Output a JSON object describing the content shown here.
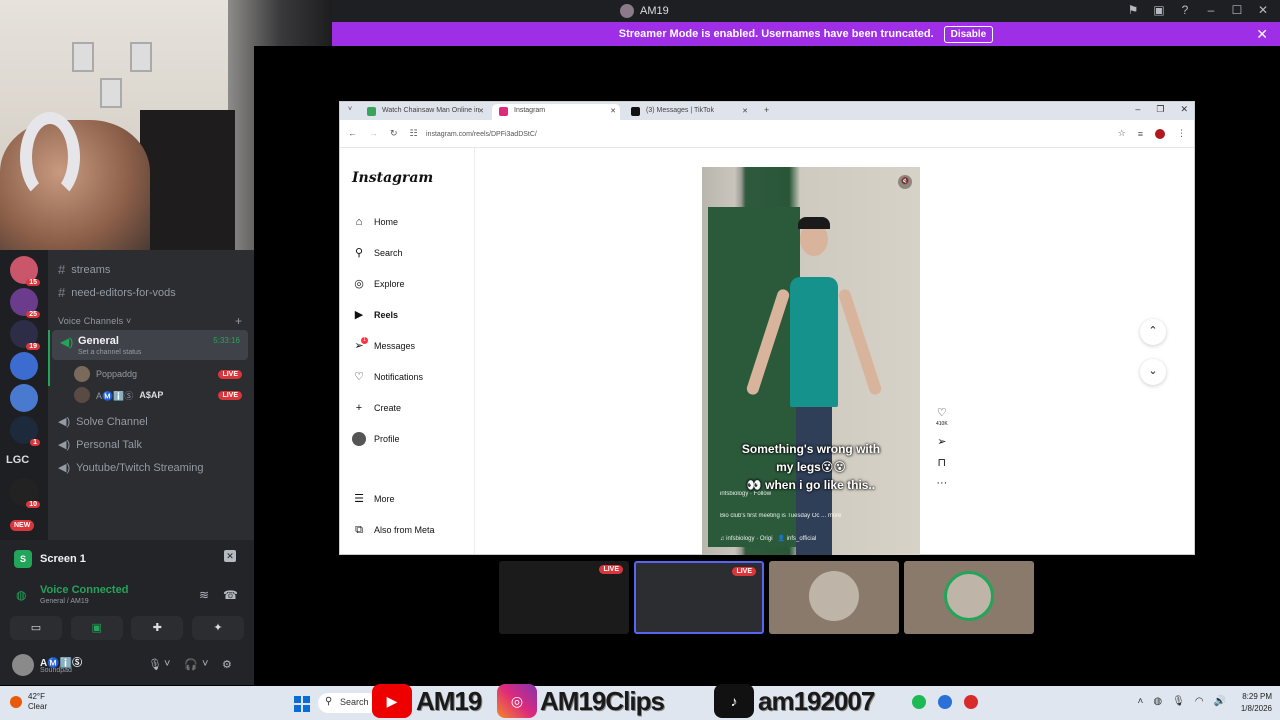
{
  "discord_topbar": {
    "title": "AM19"
  },
  "streamer_mode": {
    "message": "Streamer Mode is enabled. Usernames have been truncated.",
    "disable_label": "Disable"
  },
  "guilds": [
    {
      "badge": "15",
      "color": "#c9566a"
    },
    {
      "badge": "25",
      "color": "#6c3c8c"
    },
    {
      "badge": "19",
      "color": "#2d2d48"
    },
    {
      "badge": "",
      "color": "#3d6cd0"
    },
    {
      "badge": "",
      "color": "#4a7ad0"
    },
    {
      "badge": "1",
      "color": "#1c2a3c"
    }
  ],
  "guild_text": "LGC",
  "guild_badge_10": "10",
  "guild_new": "NEW",
  "channels": {
    "streams": "streams",
    "editors": "need-editors-for-vods",
    "voice_header": "Voice Channels",
    "general": "General",
    "general_status": "Set a channel status",
    "general_time": "5:33:16",
    "user1": "Poppaddg",
    "user2": "AⓂ️ℹ️Ⓢ",
    "user2_tag": "A$AP",
    "live": "LIVE",
    "solve": "Solve Channel",
    "personal": "Personal Talk",
    "yt": "Youtube/Twitch Streaming"
  },
  "stream_panel": {
    "screen_label": "Screen 1",
    "voice_connected": "Voice Connected",
    "voice_sub": "General / AM19",
    "username": "AⓂ️ℹ️Ⓢ",
    "user_status": "Soundpad"
  },
  "browser": {
    "tabs": [
      "Watch Chainsaw Man Online in",
      "Instagram",
      "(3) Messages | TikTok"
    ],
    "url": "instagram.com/reels/DPFi3adDStC/"
  },
  "instagram": {
    "logo": "Instagram",
    "nav": [
      "Home",
      "Search",
      "Explore",
      "Reels",
      "Messages",
      "Notifications",
      "Create",
      "Profile",
      "More",
      "Also from Meta"
    ],
    "messages_badge": "1",
    "reel_caption_1": "Something's wrong with",
    "reel_caption_2": "my legs😵😵",
    "reel_caption_3": "👀 when i go like this..",
    "reel_user": "infsbiology · Follow",
    "reel_desc": "Bio club's first meeting is Tuesday Oc ... more",
    "reel_audio": "infsbiology · Origi",
    "reel_tag": "infs_official",
    "likes": "410K"
  },
  "thumbs": {
    "live": "LIVE"
  },
  "taskbar": {
    "temp": "42°F",
    "cond": "Clear",
    "search": "Search",
    "ov1": "AM19",
    "ov2": "AM19Clips",
    "ov3": "am192007",
    "time": "8:29 PM",
    "date": "1/8/2026"
  }
}
